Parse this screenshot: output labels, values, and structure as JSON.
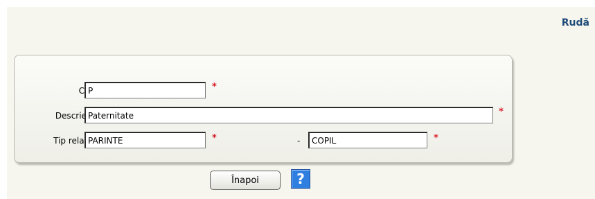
{
  "page": {
    "title": "Rudă"
  },
  "form": {
    "cod": {
      "label": "Cod",
      "value": "P",
      "required": "*"
    },
    "descriere": {
      "label": "Descriere",
      "value": "Paternitate",
      "required": "*"
    },
    "tip_relatie": {
      "label": "Tip relaţie",
      "value_from": "PARINTE",
      "separator": "-",
      "value_to": "COPIL",
      "required": "*"
    }
  },
  "actions": {
    "back_label": "Înapoi",
    "help_glyph": "?"
  },
  "icons": {
    "help": "help-question-icon"
  },
  "colors": {
    "title": "#1f4b78",
    "required": "#d8202a",
    "help_bg": "#2f7fe0"
  }
}
